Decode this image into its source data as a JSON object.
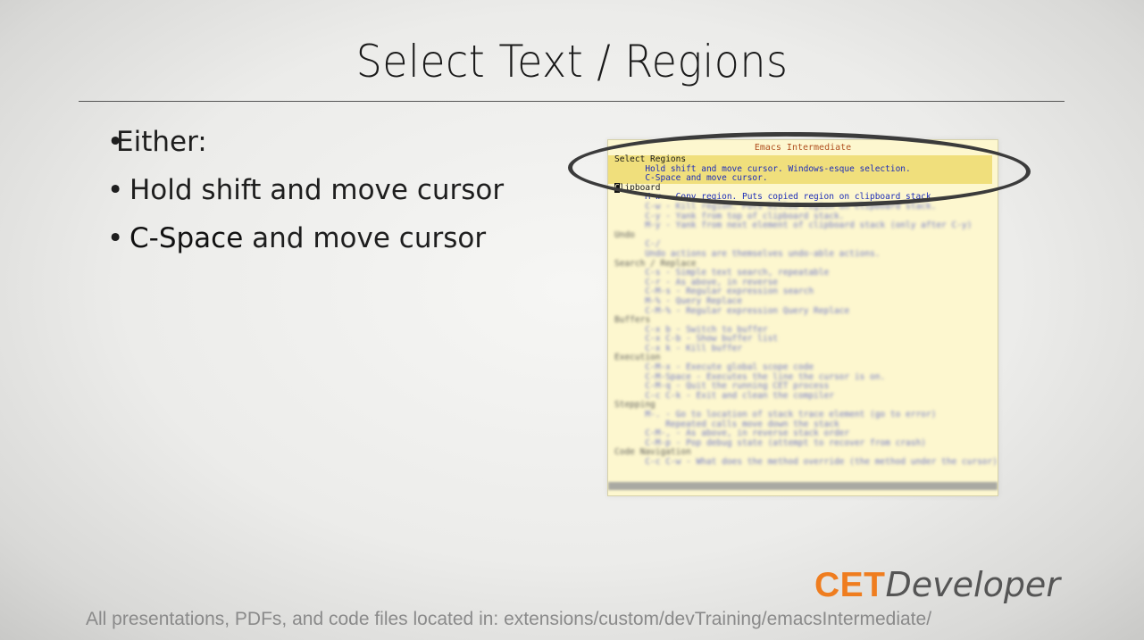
{
  "slide": {
    "title": "Select Text / Regions",
    "bullets": [
      {
        "marker": "•",
        "text": "Either:"
      },
      {
        "marker": "•",
        "text": "Hold shift and move cursor"
      },
      {
        "marker": "•",
        "strong": "C-Space",
        "text": " and move cursor"
      }
    ],
    "footer": "All presentations, PDFs, and code files located in: extensions/custom/devTraining/emacsIntermediate/"
  },
  "brand": {
    "part1": "CET",
    "part2": "Developer",
    "accent": "#ef7d1f"
  },
  "emacs": {
    "title": "Emacs Intermediate",
    "select_heading": "Select Regions",
    "select_lines": [
      "      Hold shift and move cursor. Windows-esque selection.",
      "      C-Space and move cursor."
    ],
    "cursor_char": "C",
    "clipboard_rest": "lipboard",
    "copy_line": "      M-w - Copy region. Puts copied region on clipboard stack",
    "blurred_lines": [
      {
        "t": "      C-w - Kill region. Puts killed region on clipboard stack.",
        "h": false
      },
      {
        "t": "      C-y - Yank from top of clipboard stack.",
        "h": false
      },
      {
        "t": "      M-y - Yank from next element of clipboard stack (only after C-y)",
        "h": false
      },
      {
        "t": "Undo",
        "h": true
      },
      {
        "t": "      C-/",
        "h": false
      },
      {
        "t": "      Undo actions are themselves undo-able actions.",
        "h": false
      },
      {
        "t": "Search / Replace",
        "h": true
      },
      {
        "t": "      C-s - Simple text search, repeatable",
        "h": false
      },
      {
        "t": "      C-r - As above, in reverse",
        "h": false
      },
      {
        "t": "      C-M-s - Regular expression search",
        "h": false
      },
      {
        "t": "      M-% - Query Replace",
        "h": false
      },
      {
        "t": "      C-M-% - Regular expression Query Replace",
        "h": false
      },
      {
        "t": "Buffers",
        "h": true
      },
      {
        "t": "      C-x b - Switch to buffer",
        "h": false
      },
      {
        "t": "      C-x C-b - Show buffer list",
        "h": false
      },
      {
        "t": "      C-x k - Kill buffer",
        "h": false
      },
      {
        "t": "Execution",
        "h": true
      },
      {
        "t": "      C-M-x - Execute global scope code",
        "h": false
      },
      {
        "t": "      C-M-Space - Executes the line the cursor is on.",
        "h": false
      },
      {
        "t": "      C-M-q - Quit the running CET process",
        "h": false
      },
      {
        "t": "      C-c C-k - Exit and clean the compiler",
        "h": false
      },
      {
        "t": "Stepping",
        "h": true
      },
      {
        "t": "      M-. - Go to location of stack trace element (go to error)",
        "h": false
      },
      {
        "t": "          Repeated calls move down the stack",
        "h": false
      },
      {
        "t": "      C-M-, - As above, in reverse stack order",
        "h": false
      },
      {
        "t": "      C-M-p - Pop debug state (attempt to recover from crash)",
        "h": false
      },
      {
        "t": "Code Navigation",
        "h": true
      },
      {
        "t": "      C-c C-w - What does the method override (the method under the cursor)",
        "h": false
      }
    ]
  }
}
